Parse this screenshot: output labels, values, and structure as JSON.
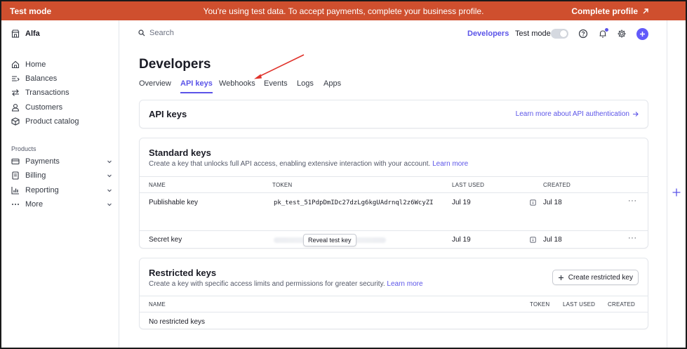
{
  "banner": {
    "mode": "Test mode",
    "message": "You're using test data. To accept payments, complete your business profile.",
    "cta": "Complete profile"
  },
  "sidebar": {
    "org": "Alfa",
    "items": [
      "Home",
      "Balances",
      "Transactions",
      "Customers",
      "Product catalog"
    ],
    "section": "Products",
    "products": [
      "Payments",
      "Billing",
      "Reporting",
      "More"
    ]
  },
  "header": {
    "search_placeholder": "Search",
    "developers": "Developers",
    "test_mode": "Test mode"
  },
  "page": {
    "title": "Developers",
    "tabs": [
      "Overview",
      "API keys",
      "Webhooks",
      "Events",
      "Logs",
      "Apps"
    ],
    "active_tab": "API keys"
  },
  "api_keys": {
    "title": "API keys",
    "link": "Learn more about API authentication"
  },
  "standard": {
    "title": "Standard keys",
    "desc": "Create a key that unlocks full API access, enabling extensive interaction with your account.",
    "learn": "Learn more",
    "columns": [
      "NAME",
      "TOKEN",
      "LAST USED",
      "CREATED"
    ],
    "rows": [
      {
        "name": "Publishable key",
        "token": "pk_test_51PdpDmIDc27dzLg6kgUAdrnql2z6WcyZI",
        "last_used": "Jul 19",
        "created": "Jul 18"
      },
      {
        "name": "Secret key",
        "token": "",
        "last_used": "Jul 19",
        "created": "Jul 18"
      }
    ],
    "reveal": "Reveal test key",
    "more": "···"
  },
  "restricted": {
    "title": "Restricted keys",
    "desc": "Create a key with specific access limits and permissions for greater security.",
    "learn": "Learn more",
    "button": "Create restricted key",
    "columns": [
      "NAME",
      "TOKEN",
      "LAST USED",
      "CREATED"
    ],
    "empty": "No restricted keys"
  },
  "colors": {
    "banner": "#cf4f2e",
    "accent": "#5b54e8"
  }
}
